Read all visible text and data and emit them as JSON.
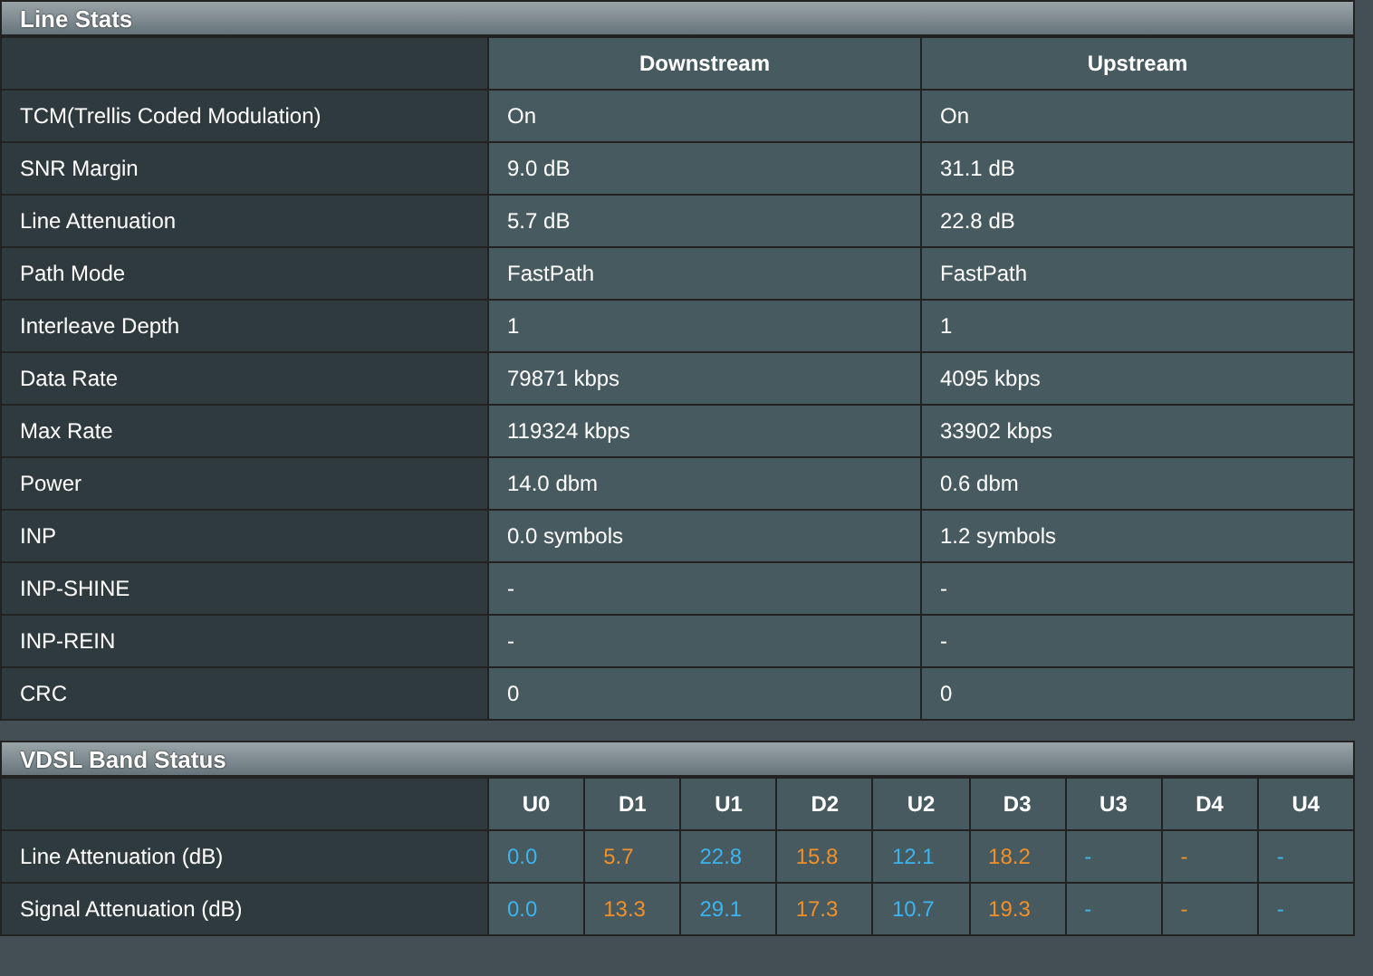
{
  "line_stats": {
    "title": "Line Stats",
    "columns": [
      "Downstream",
      "Upstream"
    ],
    "rows": [
      {
        "label": "TCM(Trellis Coded Modulation)",
        "values": [
          "On",
          "On"
        ]
      },
      {
        "label": "SNR Margin",
        "values": [
          "9.0 dB",
          "31.1 dB"
        ]
      },
      {
        "label": "Line Attenuation",
        "values": [
          "5.7 dB",
          "22.8 dB"
        ]
      },
      {
        "label": "Path Mode",
        "values": [
          "FastPath",
          "FastPath"
        ]
      },
      {
        "label": "Interleave Depth",
        "values": [
          "1",
          "1"
        ]
      },
      {
        "label": "Data Rate",
        "values": [
          "79871 kbps",
          "4095 kbps"
        ]
      },
      {
        "label": "Max Rate",
        "values": [
          "119324 kbps",
          "33902 kbps"
        ]
      },
      {
        "label": "Power",
        "values": [
          "14.0 dbm",
          "0.6 dbm"
        ]
      },
      {
        "label": "INP",
        "values": [
          "0.0 symbols",
          "1.2 symbols"
        ]
      },
      {
        "label": "INP-SHINE",
        "values": [
          "-",
          "-"
        ]
      },
      {
        "label": "INP-REIN",
        "values": [
          "-",
          "-"
        ]
      },
      {
        "label": "CRC",
        "values": [
          "0",
          "0"
        ]
      }
    ]
  },
  "vdsl_band_status": {
    "title": "VDSL Band Status",
    "bands": [
      {
        "label": "U0",
        "color": "#3cb4ee"
      },
      {
        "label": "D1",
        "color": "#f0902a"
      },
      {
        "label": "U1",
        "color": "#3cb4ee"
      },
      {
        "label": "D2",
        "color": "#f0902a"
      },
      {
        "label": "U2",
        "color": "#3cb4ee"
      },
      {
        "label": "D3",
        "color": "#f0902a"
      },
      {
        "label": "U3",
        "color": "#3cb4ee"
      },
      {
        "label": "D4",
        "color": "#f0902a"
      },
      {
        "label": "U4",
        "color": "#3cb4ee"
      }
    ],
    "rows": [
      {
        "label": "Line Attenuation (dB)",
        "values": [
          "0.0",
          "5.7",
          "22.8",
          "15.8",
          "12.1",
          "18.2",
          "-",
          "-",
          "-"
        ]
      },
      {
        "label": "Signal Attenuation (dB)",
        "values": [
          "0.0",
          "13.3",
          "29.1",
          "17.3",
          "10.7",
          "19.3",
          "-",
          "-",
          "-"
        ]
      }
    ]
  }
}
